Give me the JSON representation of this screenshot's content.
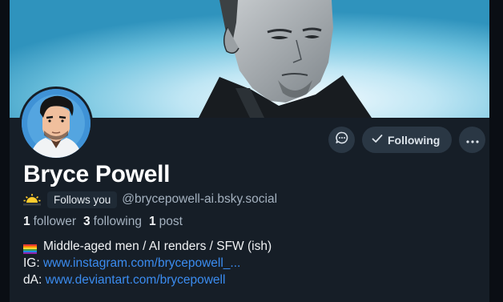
{
  "profile": {
    "display_name": "Bryce Powell",
    "follows_you": "Follows you",
    "handle": "@brycepowell-ai.bsky.social"
  },
  "actions": {
    "following_label": "Following"
  },
  "stats": {
    "followers_count": "1",
    "followers_label": "follower",
    "following_count": "3",
    "following_label": "following",
    "posts_count": "1",
    "posts_label": "post"
  },
  "bio": {
    "line1": "Middle-aged men / AI renders / SFW (ish)",
    "ig_prefix": "IG:",
    "ig_link": "www.instagram.com/brycepowell_...",
    "da_prefix": "dA:",
    "da_link": "www.deviantart.com/brycepowell"
  },
  "colors": {
    "background": "#161e27",
    "button_bg": "#2a3744",
    "link": "#3b8cf0",
    "muted_text": "#a4b1bf"
  },
  "icons": {
    "message": "chat-bubble-icon",
    "following_check": "checkmark-icon",
    "more": "ellipsis-icon",
    "name_emoji": "sunrise-emoji-icon",
    "bio_emoji": "rainbow-flag-icon"
  }
}
